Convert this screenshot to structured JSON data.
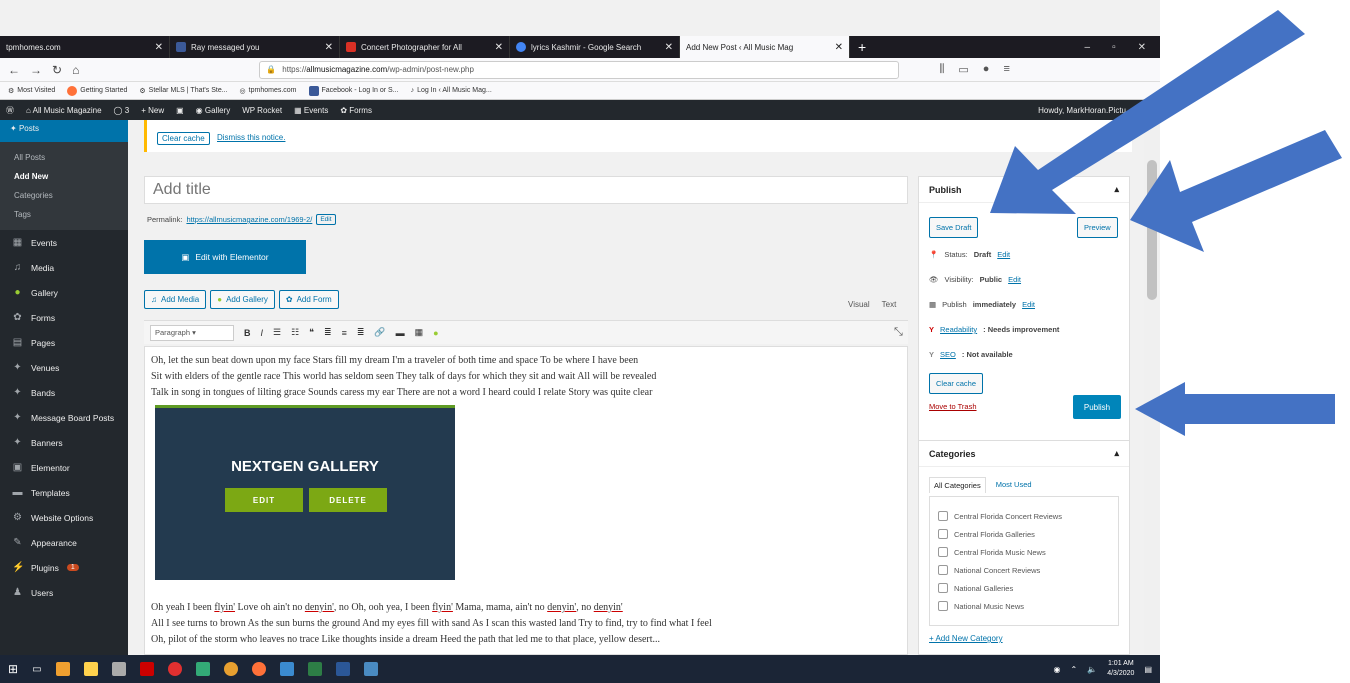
{
  "browser": {
    "tabs": [
      {
        "label": "tpmhomes.com",
        "favicon_color": "#1c1b22"
      },
      {
        "label": "Ray messaged you",
        "favicon_color": "#3b5998"
      },
      {
        "label": "Concert Photographer for All",
        "favicon_color": "#d93025"
      },
      {
        "label": "lyrics Kashmir - Google Search",
        "favicon_color": "#4285f4"
      },
      {
        "label": "Add New Post ‹ All Music Mag",
        "favicon_color": "#777777"
      }
    ],
    "url_prefix": "https://",
    "url_domain": "allmusicmagazine.com",
    "url_path": "/wp-admin/post-new.php",
    "bookmarks": [
      "Most Visited",
      "Getting Started",
      "Stellar MLS | That's Ste...",
      "tpmhomes.com",
      "Facebook - Log In or S...",
      "Log In ‹ All Music Mag..."
    ]
  },
  "adminbar": {
    "site": "All Music Magazine",
    "comments": "3",
    "new": "New",
    "items": [
      "Gallery",
      "WP Rocket",
      "Events",
      "Forms"
    ],
    "howdy": "Howdy, MarkHoran.Pictu"
  },
  "sidebar": {
    "posts": "Posts",
    "sub": [
      "All Posts",
      "Add New",
      "Categories",
      "Tags"
    ],
    "items": [
      {
        "label": "Events",
        "icon": "calendar-icon"
      },
      {
        "label": "Media",
        "icon": "media-icon"
      },
      {
        "label": "Gallery",
        "icon": "gallery-icon"
      },
      {
        "label": "Forms",
        "icon": "forms-icon"
      },
      {
        "label": "Pages",
        "icon": "pages-icon"
      },
      {
        "label": "Venues",
        "icon": "pin-icon"
      },
      {
        "label": "Bands",
        "icon": "pin-icon"
      },
      {
        "label": "Message Board Posts",
        "icon": "pin-icon"
      },
      {
        "label": "Banners",
        "icon": "pin-icon"
      },
      {
        "label": "Elementor",
        "icon": "elementor-icon"
      },
      {
        "label": "Templates",
        "icon": "folder-icon"
      },
      {
        "label": "Website Options",
        "icon": "gear-icon"
      },
      {
        "label": "Appearance",
        "icon": "brush-icon"
      },
      {
        "label": "Plugins",
        "icon": "plug-icon",
        "badge": "1"
      },
      {
        "label": "Users",
        "icon": "user-icon"
      }
    ]
  },
  "notice": {
    "clear_cache": "Clear cache",
    "dismiss": "Dismiss this notice."
  },
  "editor": {
    "title_placeholder": "Add title",
    "permalink_label": "Permalink:",
    "permalink_url": "https://allmusicmagazine.com/1969-2/",
    "permalink_edit": "Edit",
    "elementor": "Edit with Elementor",
    "add_media": "Add Media",
    "add_gallery": "Add Gallery",
    "add_form": "Add Form",
    "visual": "Visual",
    "text": "Text",
    "paragraph": "Paragraph",
    "lines1": [
      "Oh, let the sun beat down upon my face Stars fill my dream I'm a traveler of both time and space To be where I have been",
      "Sit with elders of the gentle race This world has seldom seen They talk of days for which they sit and wait All will be revealed",
      "Talk in song in tongues of lilting grace Sounds caress my ear There are not a word I heard could I relate Story was quite clear"
    ],
    "gallery": {
      "title": "NEXTGEN GALLERY",
      "edit": "EDIT",
      "delete": "DELETE"
    },
    "line4": {
      "a": "Oh yeah I been ",
      "b": "flyin'",
      "c": " Love oh ain't no ",
      "d": "denyin'",
      "e": ", no Oh, ooh yea, I been ",
      "f": "flyin'",
      "g": " Mama, mama, ain't no ",
      "h": "denyin'",
      "i": ", no ",
      "j": "denyin'"
    },
    "lines2": [
      "All I see turns to brown As the sun burns the ground And my eyes fill with sand As I scan this wasted land Try to find, try to find what I feel",
      "Oh, pilot of the storm who leaves no trace Like thoughts inside a dream Heed the path that led me to that place, yellow desert..."
    ]
  },
  "publish": {
    "title": "Publish",
    "save_draft": "Save Draft",
    "preview": "Preview",
    "status_label": "Status:",
    "status_value": "Draft",
    "visibility_label": "Visibility:",
    "visibility_value": "Public",
    "publish_label": "Publish",
    "publish_value": "immediately",
    "edit": "Edit",
    "readability_link": "Readability",
    "readability_value": ": Needs improvement",
    "seo_link": "SEO",
    "seo_value": ": Not available",
    "clear_cache": "Clear cache",
    "trash": "Move to Trash",
    "publish_btn": "Publish"
  },
  "categories": {
    "title": "Categories",
    "tab_all": "All Categories",
    "tab_used": "Most Used",
    "items": [
      "Central Florida Concert Reviews",
      "Central Florida Galleries",
      "Central Florida Music News",
      "National Concert Reviews",
      "National Galleries",
      "National Music News"
    ],
    "add": "+ Add New Category"
  },
  "taskbar": {
    "time": "1:01 AM",
    "date": "4/3/2020"
  },
  "colors": {
    "arrow": "#4472c4",
    "wp_blue": "#0073aa",
    "admin_dark": "#23282d"
  }
}
